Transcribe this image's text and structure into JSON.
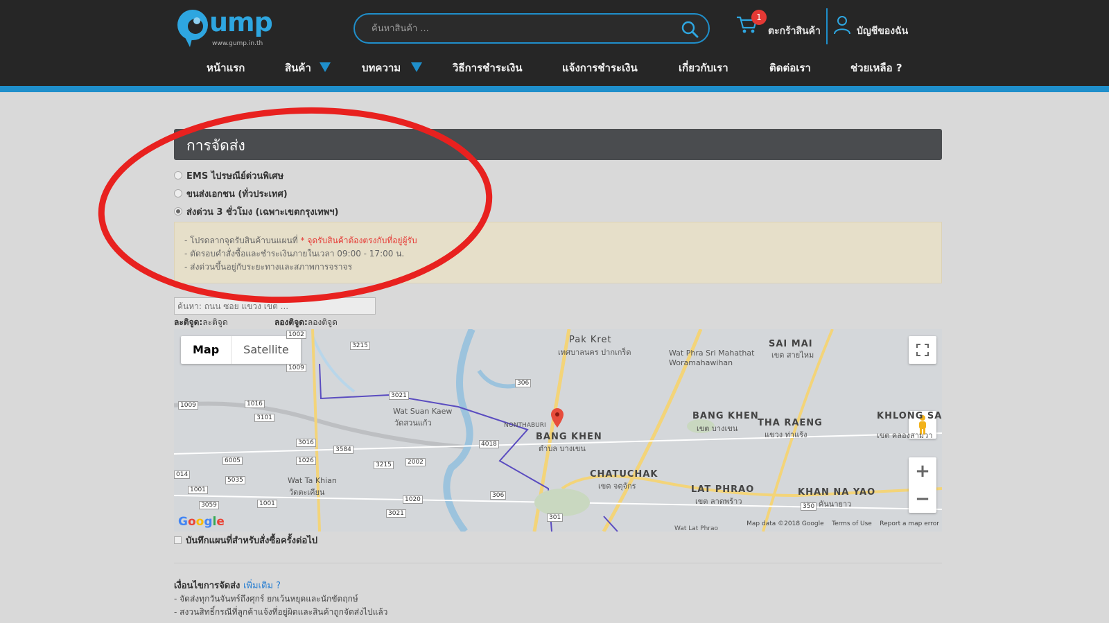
{
  "brand": {
    "logo_text": "ump",
    "logo_sub": "www.gump.in.th",
    "accent": "#1f8fcb",
    "header_bg": "#262626"
  },
  "search": {
    "placeholder": "ค้นหาสินค้า ..."
  },
  "cart": {
    "count": "1",
    "label": "ตะกร้าสินค้า"
  },
  "account": {
    "label": "บัญชีของฉัน"
  },
  "nav": {
    "items": [
      {
        "label": "หน้าแรก"
      },
      {
        "label": "สินค้า"
      },
      {
        "label": "บทความ"
      },
      {
        "label": "วิธีการชำระเงิน"
      },
      {
        "label": "แจ้งการชำระเงิน"
      },
      {
        "label": "เกี่ยวกับเรา"
      },
      {
        "label": "ติดต่อเรา"
      },
      {
        "label": "ช่วยเหลือ ?"
      }
    ]
  },
  "shipping": {
    "title": "การจัดส่ง",
    "options": [
      {
        "label": "EMS ไปรษณีย์ด่วนพิเศษ",
        "checked": false
      },
      {
        "label": "ขนส่งเอกชน (ทั่วประเทศ)",
        "checked": false
      },
      {
        "label": "ส่งด่วน 3 ชั่วโมง (เฉพาะเขตกรุงเทพฯ)",
        "checked": true
      }
    ],
    "notice": {
      "line1_prefix": "- โปรดลากจุดรับสินค้าบนแผนที่",
      "line1_red": "* จุดรับสินค้าต้องตรงกับที่อยู่ผู้รับ",
      "line2": "- ตัดรอบคำสั่งซื้อและชำระเงินภายในเวลา 09:00 - 17:00 น.",
      "line3": "- ส่งด่วนขึ้นอยู่กับระยะทางและสภาพการจราจร"
    },
    "address_placeholder": "ค้นหา: ถนน ซอย แขวง เขต ...",
    "latitude_label": "ละติจูด:",
    "latitude_value": "ละติจูด",
    "longitude_label": "ลองติจูด:",
    "longitude_value": "ลองติจูด",
    "save_map_label": "บันทึกแผนที่สำหรับสั่งซื้อครั้งต่อไป"
  },
  "map": {
    "btn_map": "Map",
    "btn_satellite": "Satellite",
    "labels": [
      {
        "text": "Pak Kret",
        "sub": "เทศบาลนคร ปากเกร็ด"
      },
      {
        "text": "SAI MAI",
        "sub": "เขต สายไหม"
      },
      {
        "text": "Wat Phra Sri Mahathat",
        "sub": "Woramahawihan"
      },
      {
        "text": "BANG KHEN",
        "sub": "เขต บางเขน"
      },
      {
        "text": "THA RAENG",
        "sub": "แขวง ท่าแร้ง"
      },
      {
        "text": "KHLONG SAM WA",
        "sub": "เขต คลองสามวา"
      },
      {
        "text": "BANG KHEN",
        "sub": "ตำบล บางเขน"
      },
      {
        "text": "CHATUCHAK",
        "sub": "เขต จตุจักร"
      },
      {
        "text": "LAT PHRAO",
        "sub": "เขต ลาดพร้าว"
      },
      {
        "text": "KHAN NA YAO",
        "sub": "เขต คันนายาว"
      },
      {
        "text": "Wat Suan Kaew",
        "sub": "วัดสวนแก้ว"
      },
      {
        "text": "Wat Ta Khian",
        "sub": "วัดตะเคียน"
      },
      {
        "text": "NONTHABURI",
        "sub": ""
      },
      {
        "text": "Wat Lat Phrao",
        "sub": ""
      }
    ],
    "footer_data": "Map data ©2018 Google",
    "footer_terms": "Terms of Use",
    "footer_report": "Report a map error",
    "google": "Google"
  },
  "conditions": {
    "title": "เงื่อนไขการจัดส่ง",
    "more": "เพิ่มเติม ?",
    "line1": "- จัดส่งทุกวันจันทร์ถึงศุกร์ ยกเว้นหยุดและนักขัตฤกษ์",
    "line2": "- สงวนสิทธิ์กรณีที่ลูกค้าแจ้งที่อยู่ผิดและสินค้าถูกจัดส่งไปแล้ว"
  },
  "annotation_color": "#e8211f"
}
